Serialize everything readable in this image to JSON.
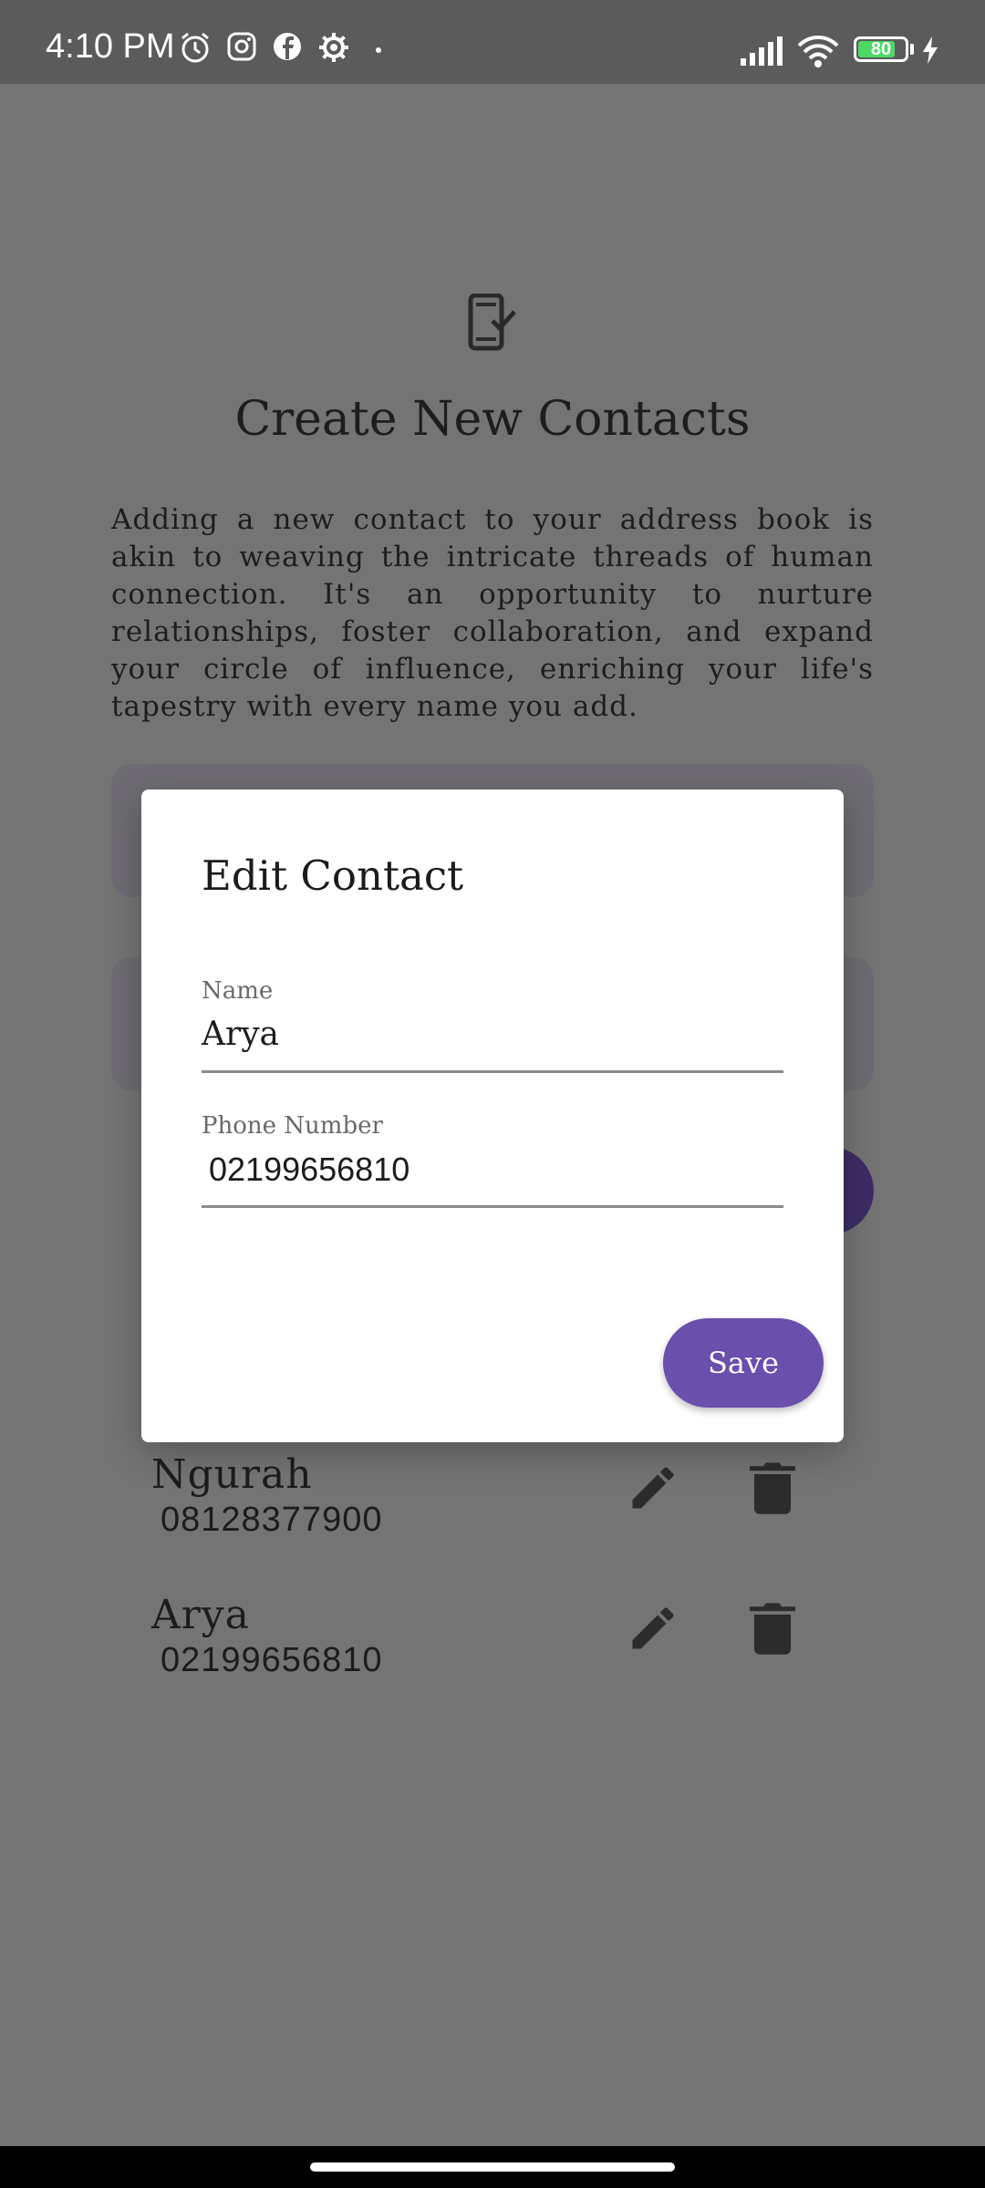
{
  "status_bar": {
    "time": "4:10 PM",
    "notification_icons": [
      "alarm-icon",
      "instagram-icon",
      "facebook-icon",
      "settings-icon",
      "dot-icon"
    ],
    "battery_level": "80",
    "battery_fraction": 0.8,
    "charging": true
  },
  "page": {
    "title": "Create New Contacts",
    "description": "Adding a new contact to your address book is akin to weaving the intricate threads of human connection. It's an opportunity to nurture relationships, foster collaboration, and expand your circle of influence, enriching your life's tapestry with every name you add.",
    "contacts": [
      {
        "name": "Ngurah",
        "phone": "08128377900"
      },
      {
        "name": "Arya",
        "phone": "02199656810"
      }
    ]
  },
  "dialog": {
    "title": "Edit Contact",
    "name_label": "Name",
    "name_value": "Arya",
    "phone_label": "Phone Number",
    "phone_value": "02199656810",
    "save_label": "Save"
  },
  "colors": {
    "accent": "#6a4fad",
    "scrim": "#747474",
    "status_bar": "#5b5b5b"
  }
}
